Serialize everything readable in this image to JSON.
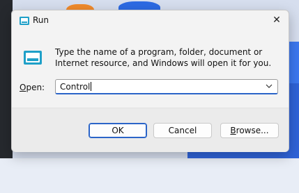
{
  "window": {
    "title": "Run",
    "close_glyph": "✕",
    "description": "Type the name of a program, folder, document or Internet resource, and Windows will open it for you."
  },
  "open": {
    "label_mnemonic": "O",
    "label_rest": "pen:",
    "value": "Control"
  },
  "buttons": {
    "ok": "OK",
    "cancel": "Cancel",
    "browse_mnemonic": "B",
    "browse_rest": "rowse..."
  },
  "icons": {
    "app": "run-icon",
    "big": "run-icon",
    "close": "close-icon",
    "dropdown": "chevron-down-icon"
  },
  "colors": {
    "accent": "#2a64c8",
    "icon_teal": "#1fa0c8"
  }
}
